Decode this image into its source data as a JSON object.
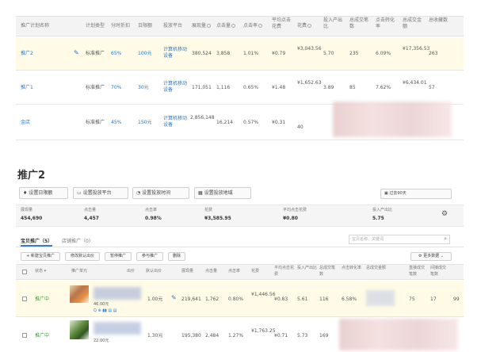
{
  "plans": {
    "headers": [
      "推广计划名称",
      "计划类型",
      "分时折扣",
      "日限额",
      "投放平台",
      "展现量",
      "点击量",
      "点击率",
      "平均点击花费",
      "花费",
      "投入产出比",
      "总成交笔数",
      "点击转化率",
      "总成交金额",
      "总收藏数"
    ],
    "rows": [
      {
        "name": "推广2",
        "type": "标准推广",
        "discount": "65%",
        "limit": "100元",
        "platform": "计算机移动设备",
        "impressions": "380,524",
        "clicks": "3,858",
        "ctr": "1.01%",
        "cpc": "¥0.79",
        "cost": "¥3,043.56",
        "roi": "5.70",
        "orders": "235",
        "cvr": "6.09%",
        "gmv": "¥17,356.53",
        "favs": "263"
      },
      {
        "name": "推广1",
        "type": "标准推广",
        "discount": "70%",
        "limit": "30元",
        "platform": "计算机移动设备",
        "impressions": "171,051",
        "clicks": "1,116",
        "ctr": "0.65%",
        "cpc": "¥1.48",
        "cost": "¥1,652.63",
        "roi": "3.89",
        "orders": "85",
        "cvr": "7.62%",
        "gmv": "¥6,434.01",
        "favs": "57"
      },
      {
        "name": "金店",
        "type": "标准推广",
        "discount": "45%",
        "limit": "150元",
        "platform": "计算机移动设备",
        "impressions": "2,856,148",
        "clicks": "16,214",
        "ctr": "0.57%",
        "cpc": "¥0.31",
        "cost": "40",
        "roi": "",
        "orders": "",
        "cvr": "",
        "gmv": "",
        "favs": ""
      }
    ]
  },
  "detail": {
    "title": "推广2",
    "buttons": {
      "daily_limit": "设置日限额",
      "platform": "设置投放平台",
      "time": "设置投放时间",
      "region": "设置投放地域"
    },
    "period": "过去90天",
    "stats": [
      {
        "label": "展现量",
        "value": "454,690"
      },
      {
        "label": "点击量",
        "value": "4,457"
      },
      {
        "label": "点击率",
        "value": "0.98%"
      },
      {
        "label": "花费",
        "value": "¥3,585.95"
      },
      {
        "label": "平均点击花费",
        "value": "¥0.80"
      },
      {
        "label": "投入产出比",
        "value": "5.75"
      }
    ],
    "tabs": {
      "baby": "宝贝推广（5）",
      "shop": "店铺推广（0）"
    },
    "search_placeholder": "宝贝名称、关键词",
    "actions": {
      "new": "新建宝贝推广",
      "set_default": "修改默认出价",
      "pause": "暂停推广",
      "resume": "参与推广",
      "delete": "删除",
      "more": "更多数据"
    },
    "headers": [
      "状态",
      "推广单元",
      "出价",
      "默认出价",
      "展现量",
      "点击量",
      "点击率",
      "花费",
      "平均点击花费",
      "投入产出比",
      "总成交笔数",
      "点击转化率",
      "总成交金额",
      "直接成交笔数",
      "间接成交笔数"
    ],
    "rows": [
      {
        "status": "推广中",
        "price": "46.00元",
        "bid": "1.00元",
        "impressions": "219,641",
        "clicks": "1,762",
        "ctr": "0.80%",
        "cost": "¥1,446.56",
        "cpc": "¥0.83",
        "roi": "5.61",
        "orders": "116",
        "cvr": "6.58%",
        "direct": "75",
        "indirect": "17",
        "extra": "99"
      },
      {
        "status": "推广中",
        "price": "22.00元",
        "bid": "1.30元",
        "impressions": "195,380",
        "clicks": "2,484",
        "ctr": "1.27%",
        "cost": "¥1,763.25",
        "cpc": "¥0.71",
        "roi": "5.73",
        "orders": "169",
        "cvr": "",
        "direct": "",
        "indirect": "",
        "extra": ""
      }
    ]
  }
}
